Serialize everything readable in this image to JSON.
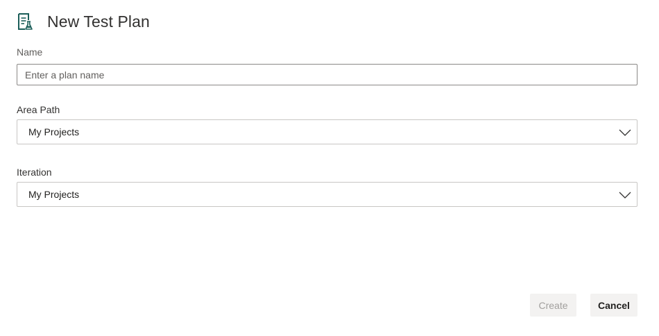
{
  "dialog": {
    "title": "New Test Plan",
    "icon": "test-plan-icon",
    "accent_color": "#1b5e59"
  },
  "name_field": {
    "label": "Name",
    "value": "",
    "placeholder": "Enter a plan name"
  },
  "area_path": {
    "label": "Area Path",
    "selected": "My Projects",
    "icon": "chevron-down-icon"
  },
  "iteration": {
    "label": "Iteration",
    "selected": "My Projects",
    "icon": "chevron-down-icon"
  },
  "actions": {
    "create_label": "Create",
    "create_enabled": false,
    "cancel_label": "Cancel"
  }
}
